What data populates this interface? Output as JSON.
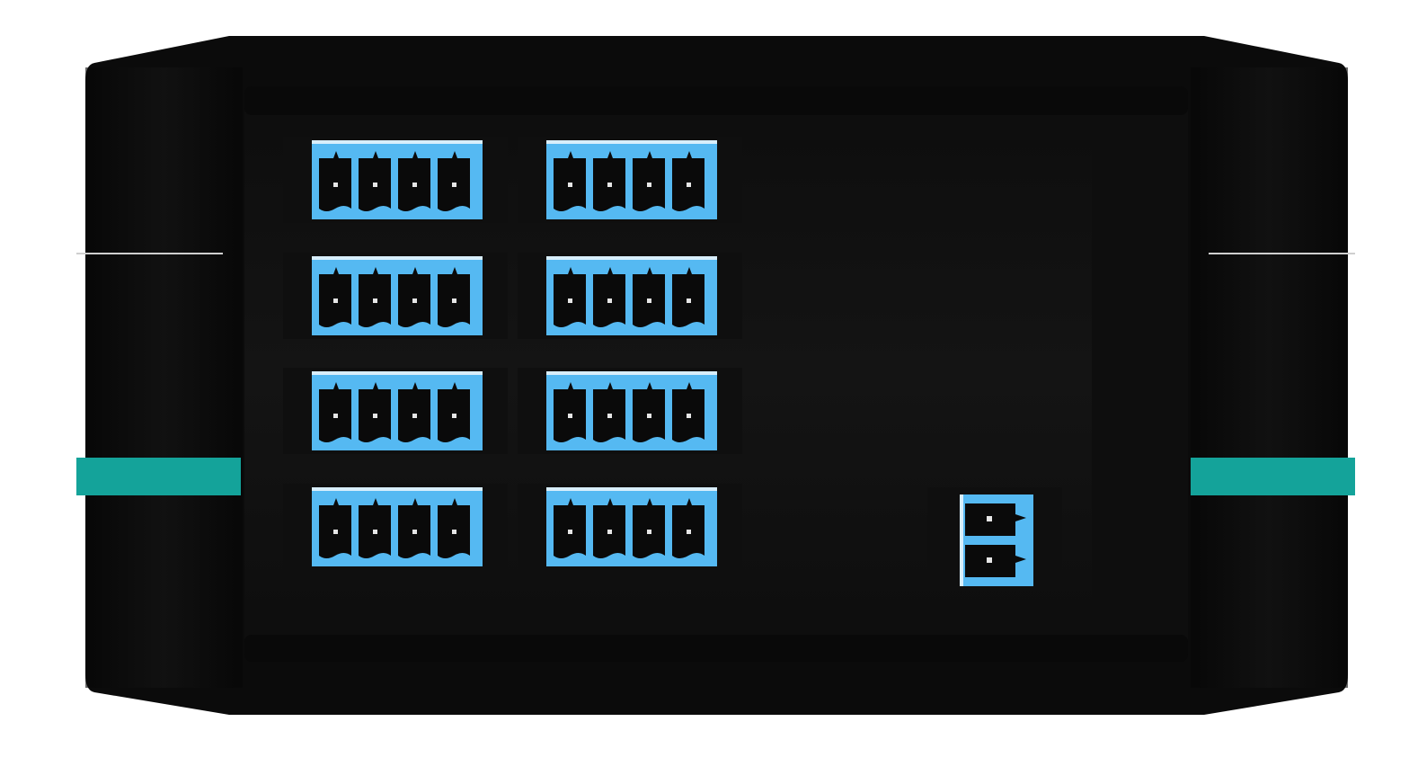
{
  "device": {
    "body_color": "#0b0b0b",
    "panel_color": "#111111",
    "accent_stripe_color": "#14a39a",
    "connector_color": "#55b9f2",
    "connector_dark": "#0a0a0a",
    "connector_groups": [
      {
        "name": "terminal-block-4pin",
        "count": 8,
        "pins_each": 4
      },
      {
        "name": "terminal-block-2pin",
        "count": 1,
        "pins_each": 2
      }
    ]
  }
}
